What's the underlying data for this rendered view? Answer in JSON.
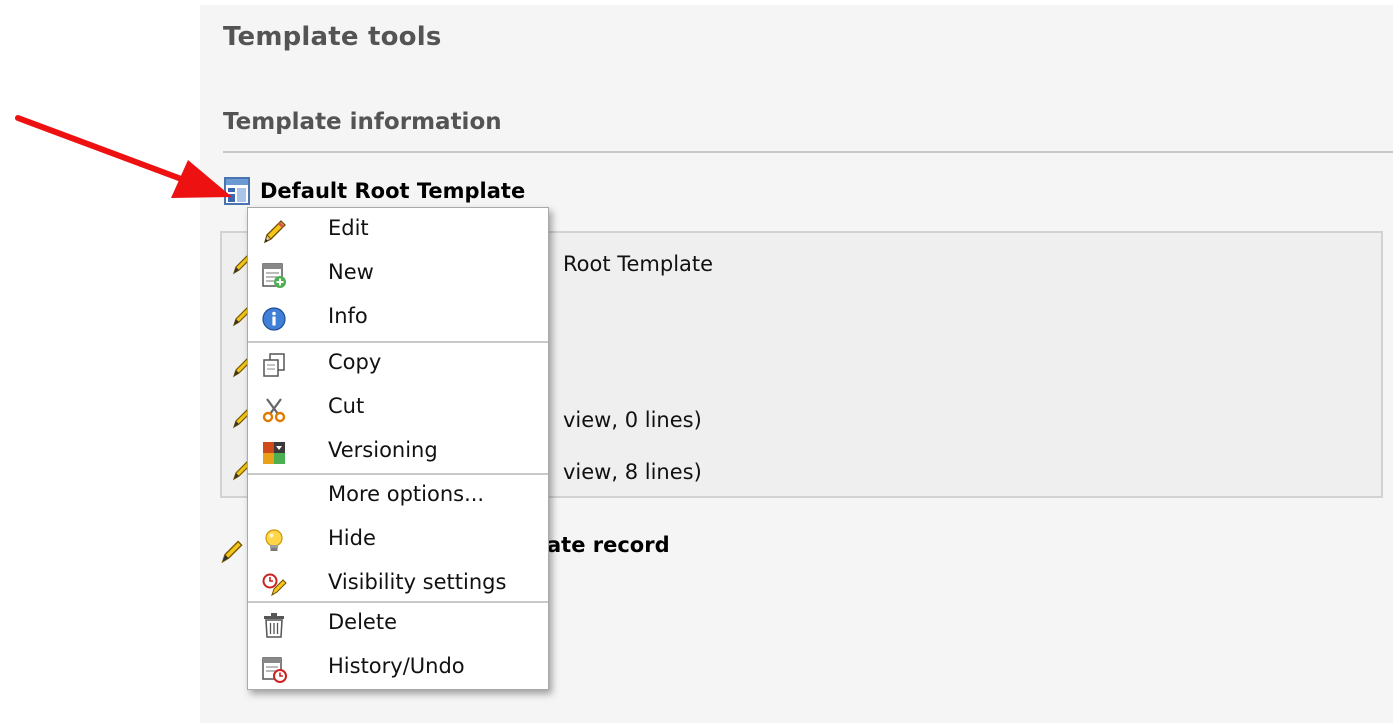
{
  "page_title": "Template tools",
  "section_title": "Template information",
  "template": {
    "title": "Default Root Template",
    "icon": "template-record-icon"
  },
  "info_rows": [
    {
      "text": "Root Template"
    },
    {
      "text": "view, 0 lines)"
    },
    {
      "text": "view, 8 lines)"
    }
  ],
  "bottom_title": "ate record",
  "context_menu": {
    "items": [
      {
        "label": "Edit",
        "icon": "pencil-icon"
      },
      {
        "label": "New",
        "icon": "new-record-icon"
      },
      {
        "label": "Info",
        "icon": "info-icon"
      },
      {
        "label": "Copy",
        "icon": "copy-icon"
      },
      {
        "label": "Cut",
        "icon": "scissors-icon"
      },
      {
        "label": "Versioning",
        "icon": "versioning-icon"
      },
      {
        "label": "More options...",
        "icon": ""
      },
      {
        "label": "Hide",
        "icon": "lightbulb-icon"
      },
      {
        "label": "Visibility settings",
        "icon": "visibility-clock-icon"
      },
      {
        "label": "Delete",
        "icon": "trash-icon"
      },
      {
        "label": "History/Undo",
        "icon": "history-icon"
      }
    ]
  },
  "colors": {
    "arrow": "#ee1111",
    "panel_bg": "#f5f5f5",
    "heading": "#545454"
  }
}
